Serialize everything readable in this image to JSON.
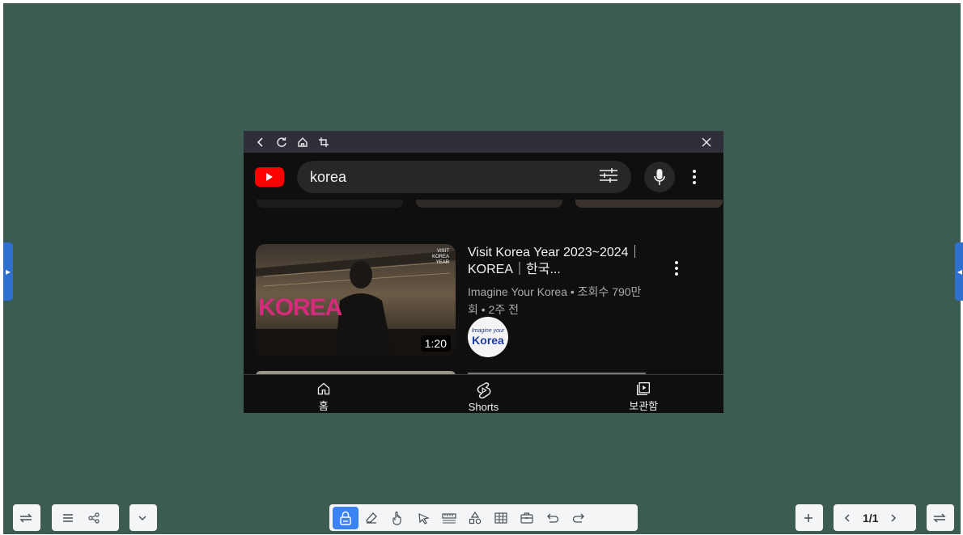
{
  "browser": {
    "url_bar_icons": [
      "back-icon",
      "refresh-icon",
      "home-icon",
      "crop-icon"
    ],
    "close_icon": "close-icon"
  },
  "youtube": {
    "search_query": "korea",
    "video": {
      "title": "Visit Korea Year 2023~2024｜KOREA｜한국...",
      "meta_line1": "Imagine Your Korea • 조회수 790만",
      "meta_line2": "회 • 2주 전",
      "duration": "1:20",
      "thumb_text": "KOREA",
      "thumb_badge": "VISIT KOREA YEAR",
      "channel_avatar_line1": "Imagine your",
      "channel_avatar_line2": "Korea"
    },
    "nav": [
      {
        "label": "홈",
        "icon": "home-icon"
      },
      {
        "label": "Shorts",
        "icon": "shorts-icon"
      },
      {
        "label": "보관함",
        "icon": "library-icon"
      }
    ]
  },
  "toolbar": {
    "page_indicator": "1/1"
  },
  "colors": {
    "board": "#3c5b52",
    "accent": "#3b82f6",
    "youtube_red": "#ff0000"
  }
}
